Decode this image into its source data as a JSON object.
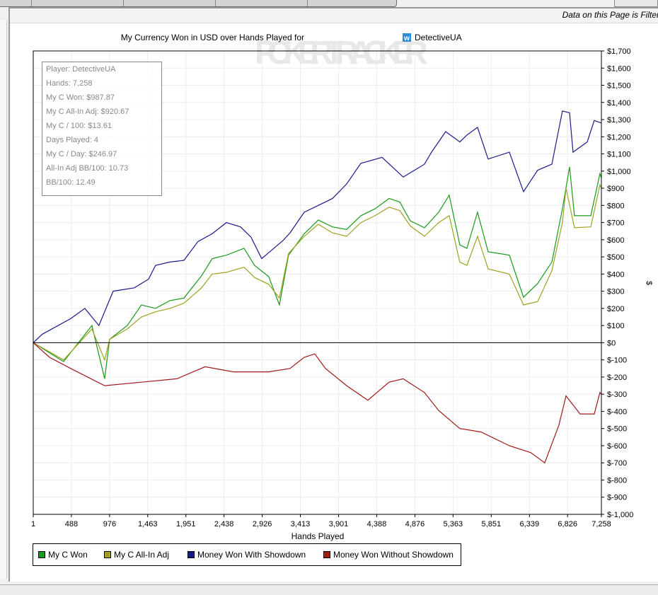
{
  "filter_notice": "Data on this Page is Filter",
  "stats": {
    "player": "Player: DetectiveUA",
    "hands": "Hands: 7,258",
    "won": "My C Won: $987.87",
    "allin": "My C All-In Adj: $920.67",
    "per100": "My C / 100: $13.61",
    "days": "Days Played: 4",
    "perday": "My C / Day: $246.97",
    "allinbb": "All-In Adj BB/100: 10.73",
    "bb100": "BB/100: 12.49"
  },
  "watermark": "POKERTRACKER",
  "chart_data": {
    "type": "line",
    "title": "My Currency Won in USD over Hands Played for",
    "title_player": "DetectiveUA",
    "xlabel": "Hands Played",
    "ylabel": "$",
    "xlim": [
      1,
      7258
    ],
    "ylim": [
      -1000,
      1700
    ],
    "xticks": [
      "1",
      "488",
      "976",
      "1,463",
      "1,951",
      "2,438",
      "2,926",
      "3,413",
      "3,901",
      "4,388",
      "4,876",
      "5,363",
      "5,851",
      "6,339",
      "6,826",
      "7,258"
    ],
    "yticks": [
      "$1,700",
      "$1,600",
      "$1,500",
      "$1,400",
      "$1,300",
      "$1,200",
      "$1,100",
      "$1,000",
      "$900",
      "$800",
      "$700",
      "$600",
      "$500",
      "$400",
      "$300",
      "$200",
      "$100",
      "$0",
      "$-100",
      "$-200",
      "$-300",
      "$-400",
      "$-500",
      "$-600",
      "$-700",
      "$-800",
      "$-900",
      "$-1,000"
    ],
    "legend_position": "bottom-left",
    "series": [
      {
        "name": "My C Won",
        "color": "#1a9a1a",
        "points": [
          [
            1,
            0
          ],
          [
            389,
            -110
          ],
          [
            750,
            100
          ],
          [
            913,
            -210
          ],
          [
            976,
            20
          ],
          [
            1202,
            100
          ],
          [
            1383,
            220
          ],
          [
            1563,
            200
          ],
          [
            1744,
            245
          ],
          [
            1925,
            260
          ],
          [
            2151,
            390
          ],
          [
            2287,
            490
          ],
          [
            2467,
            510
          ],
          [
            2693,
            550
          ],
          [
            2829,
            450
          ],
          [
            3009,
            385
          ],
          [
            3145,
            220
          ],
          [
            3262,
            510
          ],
          [
            3462,
            635
          ],
          [
            3642,
            715
          ],
          [
            3823,
            675
          ],
          [
            4004,
            660
          ],
          [
            4185,
            740
          ],
          [
            4365,
            780
          ],
          [
            4546,
            840
          ],
          [
            4682,
            820
          ],
          [
            4817,
            710
          ],
          [
            4998,
            670
          ],
          [
            5179,
            760
          ],
          [
            5314,
            860
          ],
          [
            5450,
            570
          ],
          [
            5540,
            550
          ],
          [
            5676,
            760
          ],
          [
            5811,
            530
          ],
          [
            6082,
            510
          ],
          [
            6263,
            265
          ],
          [
            6444,
            345
          ],
          [
            6625,
            470
          ],
          [
            6760,
            780
          ],
          [
            6851,
            1025
          ],
          [
            6914,
            740
          ],
          [
            7122,
            740
          ],
          [
            7239,
            985
          ],
          [
            7258,
            960
          ]
        ]
      },
      {
        "name": "My C All-In Adj",
        "color": "#a0a020",
        "points": [
          [
            1,
            0
          ],
          [
            389,
            -100
          ],
          [
            750,
            80
          ],
          [
            913,
            -100
          ],
          [
            976,
            20
          ],
          [
            1202,
            80
          ],
          [
            1383,
            150
          ],
          [
            1563,
            180
          ],
          [
            1744,
            200
          ],
          [
            1925,
            230
          ],
          [
            2151,
            320
          ],
          [
            2287,
            400
          ],
          [
            2467,
            410
          ],
          [
            2693,
            440
          ],
          [
            2829,
            380
          ],
          [
            3009,
            340
          ],
          [
            3145,
            260
          ],
          [
            3262,
            520
          ],
          [
            3462,
            620
          ],
          [
            3642,
            690
          ],
          [
            3823,
            640
          ],
          [
            4004,
            620
          ],
          [
            4185,
            700
          ],
          [
            4365,
            740
          ],
          [
            4546,
            790
          ],
          [
            4682,
            770
          ],
          [
            4817,
            680
          ],
          [
            4998,
            620
          ],
          [
            5179,
            700
          ],
          [
            5314,
            740
          ],
          [
            5450,
            470
          ],
          [
            5540,
            450
          ],
          [
            5676,
            620
          ],
          [
            5811,
            430
          ],
          [
            6082,
            400
          ],
          [
            6263,
            220
          ],
          [
            6444,
            240
          ],
          [
            6625,
            420
          ],
          [
            6760,
            700
          ],
          [
            6806,
            900
          ],
          [
            6914,
            670
          ],
          [
            7122,
            675
          ],
          [
            7239,
            920
          ],
          [
            7258,
            900
          ]
        ]
      },
      {
        "name": "Money Won With Showdown",
        "color": "#1a1a8c",
        "points": [
          [
            1,
            0
          ],
          [
            118,
            50
          ],
          [
            479,
            140
          ],
          [
            660,
            200
          ],
          [
            840,
            100
          ],
          [
            1021,
            300
          ],
          [
            1292,
            320
          ],
          [
            1473,
            370
          ],
          [
            1563,
            450
          ],
          [
            1744,
            470
          ],
          [
            1925,
            480
          ],
          [
            2106,
            590
          ],
          [
            2287,
            635
          ],
          [
            2467,
            700
          ],
          [
            2648,
            675
          ],
          [
            2783,
            615
          ],
          [
            2919,
            490
          ],
          [
            3190,
            595
          ],
          [
            3281,
            640
          ],
          [
            3462,
            760
          ],
          [
            3642,
            800
          ],
          [
            3823,
            840
          ],
          [
            4004,
            925
          ],
          [
            4185,
            1045
          ],
          [
            4456,
            1080
          ],
          [
            4727,
            965
          ],
          [
            4998,
            1040
          ],
          [
            5088,
            1110
          ],
          [
            5269,
            1230
          ],
          [
            5450,
            1170
          ],
          [
            5540,
            1210
          ],
          [
            5676,
            1255
          ],
          [
            5811,
            1070
          ],
          [
            6082,
            1110
          ],
          [
            6263,
            880
          ],
          [
            6444,
            1005
          ],
          [
            6625,
            1040
          ],
          [
            6760,
            1350
          ],
          [
            6851,
            1340
          ],
          [
            6896,
            1110
          ],
          [
            7077,
            1170
          ],
          [
            7167,
            1295
          ],
          [
            7258,
            1280
          ]
        ]
      },
      {
        "name": "Money Won Without Showdown",
        "color": "#a01818",
        "points": [
          [
            1,
            0
          ],
          [
            208,
            -85
          ],
          [
            479,
            -150
          ],
          [
            913,
            -250
          ],
          [
            1383,
            -230
          ],
          [
            1835,
            -210
          ],
          [
            2196,
            -140
          ],
          [
            2558,
            -170
          ],
          [
            3009,
            -170
          ],
          [
            3281,
            -150
          ],
          [
            3462,
            -85
          ],
          [
            3597,
            -65
          ],
          [
            3733,
            -150
          ],
          [
            4004,
            -250
          ],
          [
            4275,
            -335
          ],
          [
            4546,
            -230
          ],
          [
            4727,
            -210
          ],
          [
            4998,
            -290
          ],
          [
            5179,
            -395
          ],
          [
            5450,
            -500
          ],
          [
            5721,
            -520
          ],
          [
            6082,
            -600
          ],
          [
            6354,
            -640
          ],
          [
            6534,
            -700
          ],
          [
            6715,
            -480
          ],
          [
            6806,
            -310
          ],
          [
            6986,
            -415
          ],
          [
            7167,
            -415
          ],
          [
            7239,
            -290
          ],
          [
            7258,
            -300
          ]
        ]
      }
    ]
  }
}
